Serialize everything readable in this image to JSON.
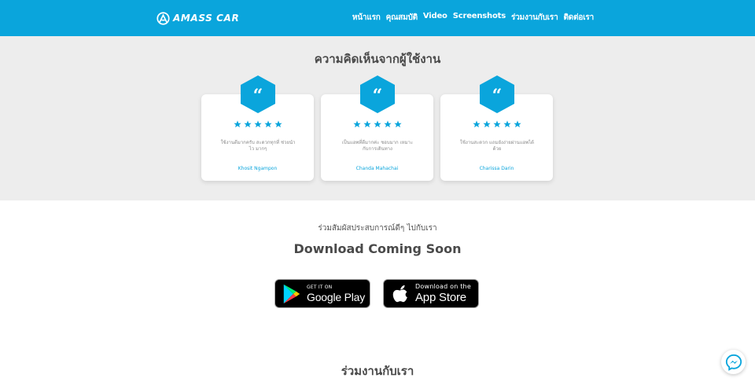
{
  "brand": {
    "name": "AMASS CAR"
  },
  "nav": [
    "หน้าแรก",
    "คุณสมบัติ",
    "Video",
    "Screenshots",
    "ร่วมงานกับเรา",
    "ติดต่อเรา"
  ],
  "reviews": {
    "title": "ความคิดเห็นจากผู้ใช้งาน",
    "items": [
      {
        "quote_mark": "“",
        "rating": 5,
        "text": "ใช้งานดีมากครับ สะดวกทุกที่ ช่วยนำไว มากๆ",
        "name": "Khosit Ngampon"
      },
      {
        "quote_mark": "“",
        "rating": 5,
        "text": "เป็นแอพที่ดีมากค่ะ ชอบมาก เหมาะกับการเดินทาง",
        "name": "Chanda Mahachai"
      },
      {
        "quote_mark": "“",
        "rating": 5,
        "text": "ใช้งานสะดวก แถมยังง่ายผ่านแอพได้ด้วย",
        "name": "Charissa Darin"
      }
    ]
  },
  "download": {
    "subtitle": "ร่วมสัมผัสประสบการณ์ดีๆ ไปกับเรา",
    "title": "Download Coming Soon",
    "google_play": {
      "small": "GET IT ON",
      "big": "Google Play"
    },
    "app_store": {
      "small": "Download on the",
      "big": "App Store"
    }
  },
  "join": {
    "title": "ร่วมงานกับเรา"
  },
  "colors": {
    "primary": "#0aa5dc",
    "section_bg": "#ededed",
    "heading": "#4a4a4a"
  },
  "icons": {
    "messenger": "messenger-icon",
    "quote": "quote-hexagon-icon",
    "star": "star-icon"
  }
}
